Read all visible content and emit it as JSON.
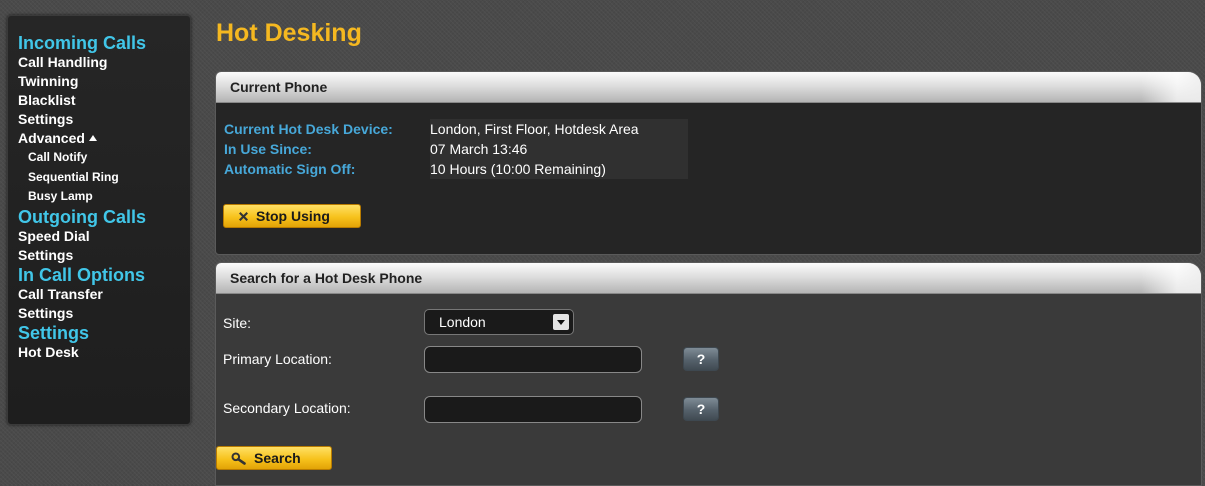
{
  "sidebar": {
    "incoming_calls": {
      "heading": "Incoming Calls",
      "items": [
        "Call Handling",
        "Twinning",
        "Blacklist",
        "Settings"
      ],
      "advanced": {
        "label": "Advanced",
        "items": [
          "Call Notify",
          "Sequential Ring",
          "Busy Lamp"
        ]
      }
    },
    "outgoing_calls": {
      "heading": "Outgoing Calls",
      "items": [
        "Speed Dial",
        "Settings"
      ]
    },
    "in_call_options": {
      "heading": "In Call Options",
      "items": [
        "Call Transfer",
        "Settings"
      ]
    },
    "settings": {
      "heading": "Settings",
      "items": [
        "Hot Desk"
      ]
    }
  },
  "page": {
    "title": "Hot Desking"
  },
  "current_phone": {
    "title": "Current Phone",
    "rows": [
      {
        "label": "Current Hot Desk Device:",
        "value": "London, First Floor, Hotdesk Area"
      },
      {
        "label": "In Use Since:",
        "value": "07 March 13:46"
      },
      {
        "label": "Automatic Sign Off:",
        "value": "10 Hours (10:00 Remaining)"
      }
    ],
    "stop_button": "Stop Using"
  },
  "search_panel": {
    "title": "Search for a Hot Desk Phone",
    "site_label": "Site:",
    "site_value": "London",
    "primary_label": "Primary Location:",
    "primary_value": "",
    "secondary_label": "Secondary Location:",
    "secondary_value": "",
    "help_label": "?",
    "search_button": "Search"
  },
  "colors": {
    "accent_title": "#f5b820",
    "nav_heading": "#41c6e8",
    "info_label": "#47a8d9",
    "button_yellow": "#f7c21c"
  },
  "icons": {
    "stop": "close-x-icon",
    "search": "magnifier-icon",
    "advanced_toggle": "caret-up-icon",
    "select": "chevron-down-icon"
  }
}
